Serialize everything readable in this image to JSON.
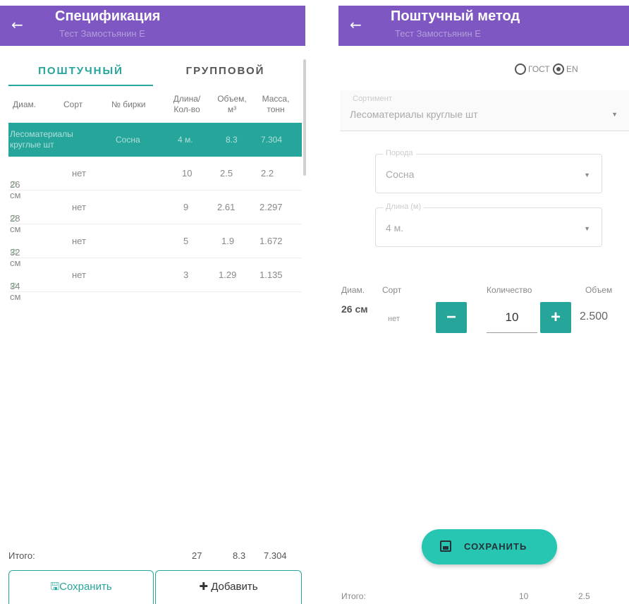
{
  "left": {
    "appbar": {
      "back_icon": "←",
      "title": "Спецификация",
      "subtitle": "Тест Замостьянин Е"
    },
    "tabs": [
      {
        "label": "ПОШТУЧНЫЙ",
        "active": true
      },
      {
        "label": "ГРУППОВОЙ",
        "active": false
      }
    ],
    "columns": {
      "diam": "Диам.",
      "sort": "Сорт",
      "tag": "№ бирки",
      "length_1": "Длина/",
      "length_2": "Кол-во",
      "volume_1": "Объем,",
      "volume_2": "м³",
      "mass_1": "Масса,",
      "mass_2": "тонн"
    },
    "group": {
      "name_1": "Лесоматериалы",
      "name_2": "круглые шт",
      "species": "Сосна",
      "length": "4 м.",
      "volume": "8.3",
      "mass": "7.304"
    },
    "rows": [
      {
        "diam": "26 см",
        "sort": "нет",
        "qty": "10",
        "volume": "2.5",
        "mass": "2.2"
      },
      {
        "diam": "28 см",
        "sort": "нет",
        "qty": "9",
        "volume": "2.61",
        "mass": "2.297"
      },
      {
        "diam": "32 см",
        "sort": "нет",
        "qty": "5",
        "volume": "1.9",
        "mass": "1.672"
      },
      {
        "diam": "34 см",
        "sort": "нет",
        "qty": "3",
        "volume": "1.29",
        "mass": "1.135"
      }
    ],
    "totals": {
      "label": "Итого:",
      "qty": "27",
      "volume": "8.3",
      "mass": "7.304"
    },
    "buttons": {
      "save_icon": "🖫",
      "save": "Сохранить",
      "add_icon": "✚",
      "add": "Добавить"
    }
  },
  "right": {
    "appbar": {
      "back_icon": "←",
      "title": "Поштучный метод",
      "subtitle": "Тест Замостьянин Е"
    },
    "radio": {
      "gost": "ГОСТ",
      "en": "EN",
      "selected": "EN"
    },
    "sortiment": {
      "label": "Сортимент",
      "value": "Лесоматериалы круглые шт"
    },
    "poroda": {
      "label": "Порода",
      "value": "Сосна"
    },
    "dlina": {
      "label": "Длина (м)",
      "value": "4 м."
    },
    "editor": {
      "col_diam": "Диам.",
      "col_sort": "Сорт",
      "col_qty": "Количество",
      "col_volume": "Объем",
      "diam": "26 см",
      "sort": "нет",
      "qty": "10",
      "volume": "2.500",
      "minus": "−",
      "plus": "+"
    },
    "save_button": "СОХРАНИТЬ",
    "totals": {
      "label": "Итого:",
      "qty": "10",
      "volume": "2.5"
    }
  },
  "colors": {
    "appbar": "#7e57c2",
    "accent": "#26a69a",
    "fab": "#26c6b2"
  }
}
